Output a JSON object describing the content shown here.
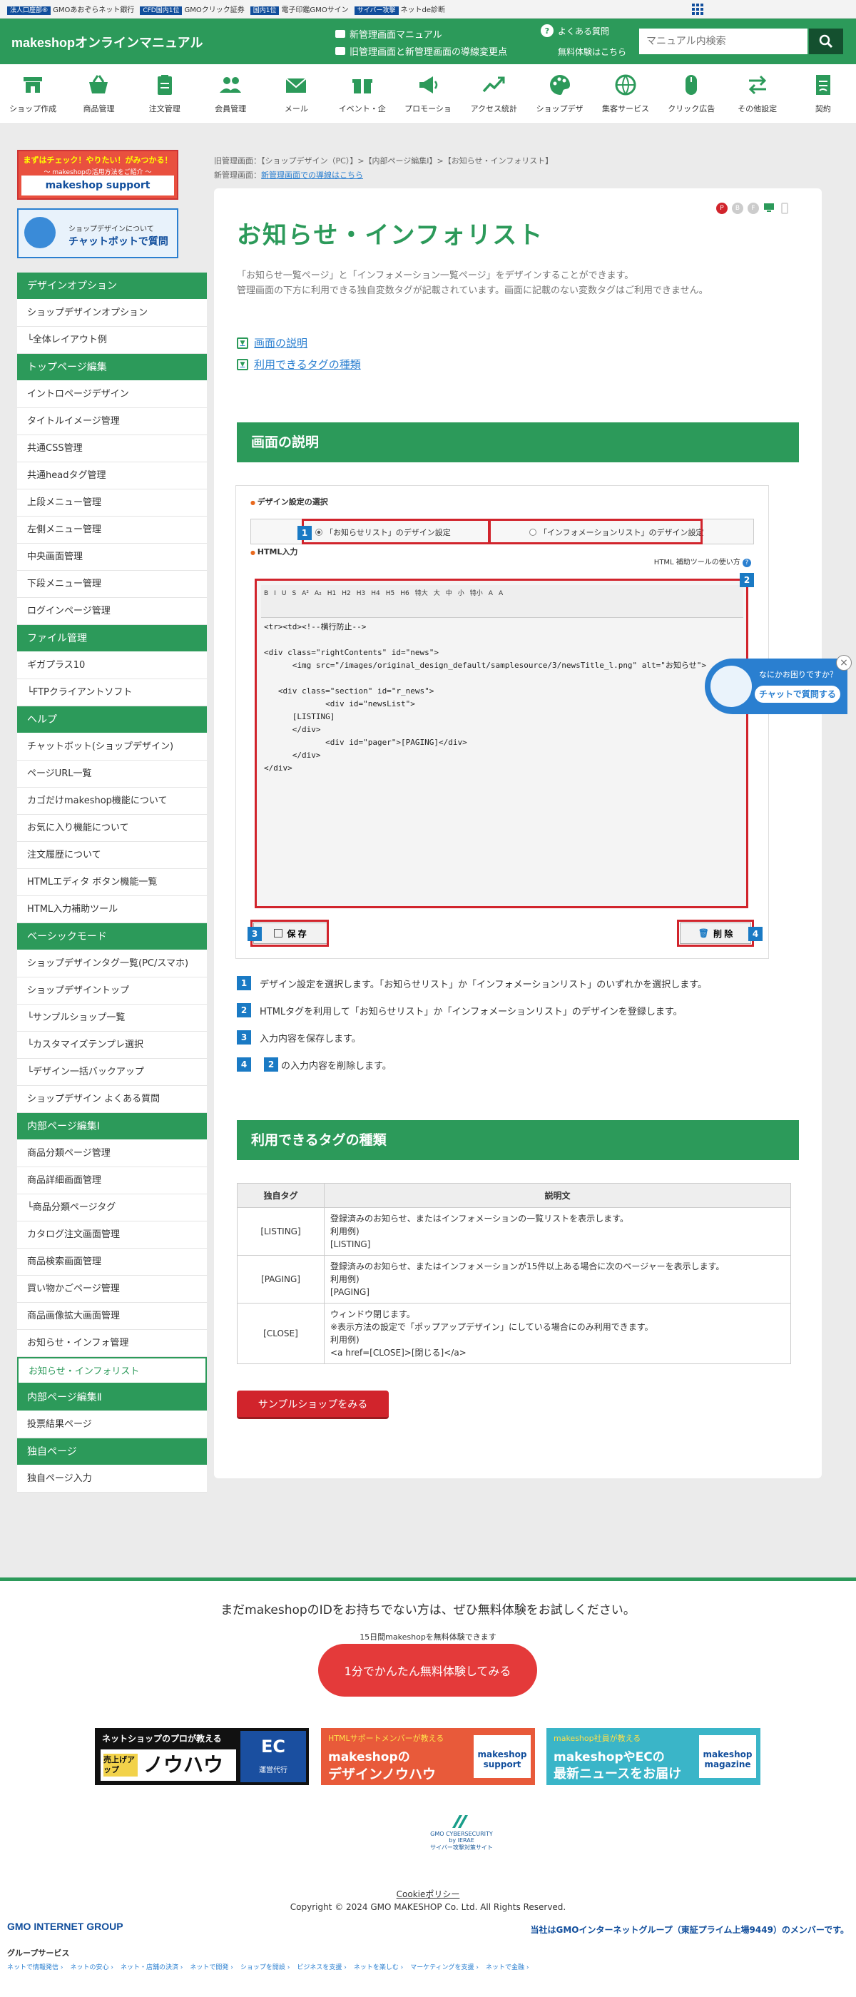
{
  "gmobar": {
    "items": [
      {
        "tag": "法人口座部⑥",
        "text": "GMOあおぞらネット銀行"
      },
      {
        "tag": "CFD国内1位",
        "text": "GMOクリック証券"
      },
      {
        "tag": "国内1位",
        "text": "電子印鑑GMOサイン"
      },
      {
        "tag": "サイバー攻撃",
        "text": "ネットde診断"
      }
    ]
  },
  "header": {
    "logo": "makeshopオンラインマニュアル",
    "link1": "新管理画面マニュアル",
    "link2": "旧管理画面と新管理画面の導線変更点",
    "faq": "よくある質問",
    "trial": "無料体験はこちら",
    "search_placeholder": "マニュアル内検索"
  },
  "nav": [
    {
      "label": "ショップ作成",
      "icon": "shop-icon"
    },
    {
      "label": "商品管理",
      "icon": "basket-icon"
    },
    {
      "label": "注文管理",
      "icon": "clipboard-icon"
    },
    {
      "label": "会員管理",
      "icon": "users-icon"
    },
    {
      "label": "メール",
      "icon": "mail-icon"
    },
    {
      "label": "イベント・企",
      "icon": "gift-icon"
    },
    {
      "label": "プロモーショ",
      "icon": "megaphone-icon"
    },
    {
      "label": "アクセス統計",
      "icon": "trend-icon"
    },
    {
      "label": "ショップデザ",
      "icon": "palette-icon"
    },
    {
      "label": "集客サービス",
      "icon": "globe-icon"
    },
    {
      "label": "クリック広告",
      "icon": "mouse-icon"
    },
    {
      "label": "その他設定",
      "icon": "swap-icon"
    },
    {
      "label": "契約",
      "icon": "contract-icon"
    }
  ],
  "sidebar": {
    "banner1_line1": "まずはチェック！やりたい！がみつかる！",
    "banner1_line2": "〜 makeshopの活用方法をご紹介 〜",
    "banner1_logo": "makeshop support",
    "banner2_line1": "ショップデザインについて",
    "banner2_line2": "チャットボットで質問",
    "groups": [
      {
        "title": "デザインオプション",
        "items": [
          "ショップデザインオプション",
          "└全体レイアウト例"
        ]
      },
      {
        "title": "トップページ編集",
        "items": [
          "イントロページデザイン",
          "タイトルイメージ管理",
          "共通CSS管理",
          "共通headタグ管理",
          "上段メニュー管理",
          "左側メニュー管理",
          "中央画面管理",
          "下段メニュー管理",
          "ログインページ管理"
        ]
      },
      {
        "title": "ファイル管理",
        "items": [
          "ギガプラス10",
          "└FTPクライアントソフト"
        ]
      },
      {
        "title": "ヘルプ",
        "items": [
          "チャットボット(ショップデザイン)",
          "ページURL一覧",
          "カゴだけmakeshop機能について",
          "お気に入り機能について",
          "注文履歴について",
          "HTMLエディタ ボタン機能一覧",
          "HTML入力補助ツール"
        ]
      },
      {
        "title": "ベーシックモード",
        "items": [
          "ショップデザインタグ一覧(PC/スマホ)",
          "ショップデザイントップ",
          "└サンプルショップ一覧",
          "└カスタマイズテンプレ選択",
          "└デザイン一括バックアップ",
          "ショップデザイン よくある質問"
        ]
      },
      {
        "title": "内部ページ編集Ⅰ",
        "items": [
          "商品分類ページ管理",
          "商品詳細画面管理",
          "└商品分類ページタグ",
          "カタログ注文画面管理",
          "商品検索画面管理",
          "買い物かごページ管理",
          "商品画像拡大画面管理",
          "お知らせ・インフォ管理",
          "お知らせ・インフォリスト"
        ]
      },
      {
        "title": "内部ページ編集Ⅱ",
        "items": [
          "投票結果ページ"
        ]
      },
      {
        "title": "独自ページ",
        "items": [
          "独自ページ入力"
        ]
      }
    ],
    "current": "お知らせ・インフォリスト"
  },
  "breadcrumb": {
    "line1": "旧管理画面：【ショップデザイン（PC）】>【内部ページ編集Ⅰ】>【お知らせ・インフォリスト】",
    "line2_prefix": "新管理画面：",
    "line2_link": "新管理画面での導線はこちら"
  },
  "main": {
    "title": "お知らせ・インフォリスト",
    "desc1": "「お知らせ一覧ページ」と「インフォメーション一覧ページ」をデザインすることができます。",
    "desc2": "管理画面の下方に利用できる独自変数タグが記載されています。画面に記載のない変数タグはご利用できません。",
    "toc1": "画面の説明",
    "toc2": "利用できるタグの種類",
    "h2_1": "画面の説明",
    "h2_2": "利用できるタグの種類",
    "devices": [
      "P",
      "B",
      "F",
      "PC",
      "SP"
    ],
    "shot": {
      "label_select": "デザイン設定の選択",
      "radio1": "「お知らせリスト」のデザイン設定",
      "radio2": "「インフォメーションリスト」のデザイン設定",
      "label_html": "HTML入力",
      "html_tool": "HTML 補助ツールの使い方",
      "toolbar": [
        "B",
        "I",
        "U",
        "S",
        "A²",
        "A₂",
        "H1",
        "H2",
        "H3",
        "H4",
        "H5",
        "H6",
        "特大",
        "大",
        "中",
        "小",
        "特小",
        "A",
        "A"
      ],
      "code": "<tr><td><!--横行防止-->\n\n<div class=\"rightContents\" id=\"news\">\n      <img src=\"/images/original_design_default/samplesource/3/newsTitle_l.png\" alt=\"お知らせ\">\n\n   <div class=\"section\" id=\"r_news\">\n             <div id=\"newsList\">\n      [LISTING]\n      </div>\n             <div id=\"pager\">[PAGING]</div>\n      </div>\n</div>",
      "save": "保 存",
      "delete": "削 除",
      "nums": [
        "1",
        "2",
        "3",
        "4"
      ]
    },
    "steps": [
      {
        "n": "1",
        "text": "デザイン設定を選択します。「お知らせリスト」か「インフォメーションリスト」のいずれかを選択します。"
      },
      {
        "n": "2",
        "text": "HTMLタグを利用して「お知らせリスト」か「インフォメーションリスト」のデザインを登録します。"
      },
      {
        "n": "3",
        "text": "入力内容を保存します。"
      },
      {
        "n": "4",
        "n2": "2",
        "text": "の入力内容を削除します。"
      }
    ],
    "table": {
      "headers": [
        "独自タグ",
        "説明文"
      ],
      "rows": [
        {
          "tag": "[LISTING]",
          "l1": "登録済みのお知らせ、またはインフォメーションの一覧リストを表示します。",
          "l2": "利用例)",
          "l3": "[LISTING]",
          "l4": ""
        },
        {
          "tag": "[PAGING]",
          "l1": "登録済みのお知らせ、またはインフォメーションが15件以上ある場合に次のページャーを表示します。",
          "l2": "利用例)",
          "l3": "[PAGING]",
          "l4": ""
        },
        {
          "tag": "[CLOSE]",
          "l1": "ウィンドウ閉じます。",
          "l2": "※表示方法の設定で「ポップアップデザイン」にしている場合にのみ利用できます。",
          "l3": "利用例)",
          "l4": "<a href=[CLOSE]>[閉じる]</a>"
        }
      ]
    },
    "sample_button": "サンプルショップをみる"
  },
  "chat": {
    "line1": "なにかお困りですか？",
    "line2": "チャットで質問する"
  },
  "footer": {
    "text": "まだmakeshopのIDをお持ちでない方は、ぜひ無料体験をお試しください。",
    "sub": "15日間makeshopを無料体験できます",
    "button": "1分でかんたん無料体験してみる",
    "banner1_a": "ネットショップのプロが教える",
    "banner1_b": "売上げアップ",
    "banner1_c": "ノウハウ",
    "banner1_d": "EC",
    "banner1_e": "運営代行",
    "banner2_a": "HTMLサポートメンバーが教える",
    "banner2_b": "makeshopの",
    "banner2_c": "デザインノウハウ",
    "banner2_d": "makeshop support",
    "banner3_a": "makeshop社員が教える",
    "banner3_b": "makeshopやECの",
    "banner3_c": "最新ニュースをお届け",
    "banner3_d": "makeshop magazine",
    "security": "GMO CYBERSECURITY by IERAE",
    "security_sub": "サイバー攻撃対策サイト",
    "cookie": "Cookieポリシー",
    "copyright": "Copyright © 2024 GMO MAKESHOP Co. Ltd. All Rights Reserved.",
    "gmo": "GMO INTERNET GROUP",
    "member": "当社はGMOインターネットグループ（東証プライム上場9449）のメンバーです。",
    "group_services": "グループサービス",
    "group_links": [
      "ネットで情報発信 ›",
      "ネットの安心 ›",
      "ネット・店舗の決済 ›",
      "ネットで開発 ›",
      "ショップを開設 ›",
      "ビジネスを支援 ›",
      "ネットを楽しむ ›",
      "マーケティングを支援 ›",
      "ネットで金融 ›"
    ]
  },
  "colors": {
    "green": "#2c9a5a",
    "red": "#d1242c",
    "blue": "#1a7ac4"
  }
}
